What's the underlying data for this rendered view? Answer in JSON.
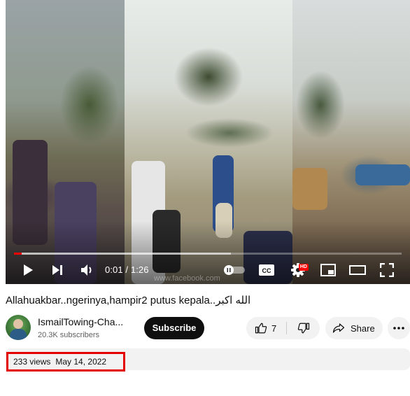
{
  "video": {
    "current_time": "0:01",
    "duration": "1:26",
    "time_separator": "/",
    "played_fraction": 0.02,
    "buffered_fraction": 0.56,
    "hd_badge": "HD",
    "watermark": "www.facebook.com"
  },
  "title": "Allahuakbar..ngerinya,hampir2 putus kepala..الله اكبر",
  "channel": {
    "name": "IsmailTowing-Cha...",
    "subscribers": "20.3K subscribers",
    "subscribe_label": "Subscribe"
  },
  "actions": {
    "like_count": "7",
    "share_label": "Share"
  },
  "description": {
    "views": "233 views",
    "date": "May 14, 2022"
  },
  "colors": {
    "progress_played": "#ff0000",
    "highlight_box": "#e50000",
    "subscribe_bg": "#0f0f0f"
  },
  "icons": [
    "play-icon",
    "next-icon",
    "volume-icon",
    "autoplay-toggle-icon",
    "captions-icon",
    "settings-icon",
    "miniplayer-icon",
    "theater-icon",
    "fullscreen-icon",
    "like-icon",
    "dislike-icon",
    "share-icon",
    "more-icon"
  ]
}
